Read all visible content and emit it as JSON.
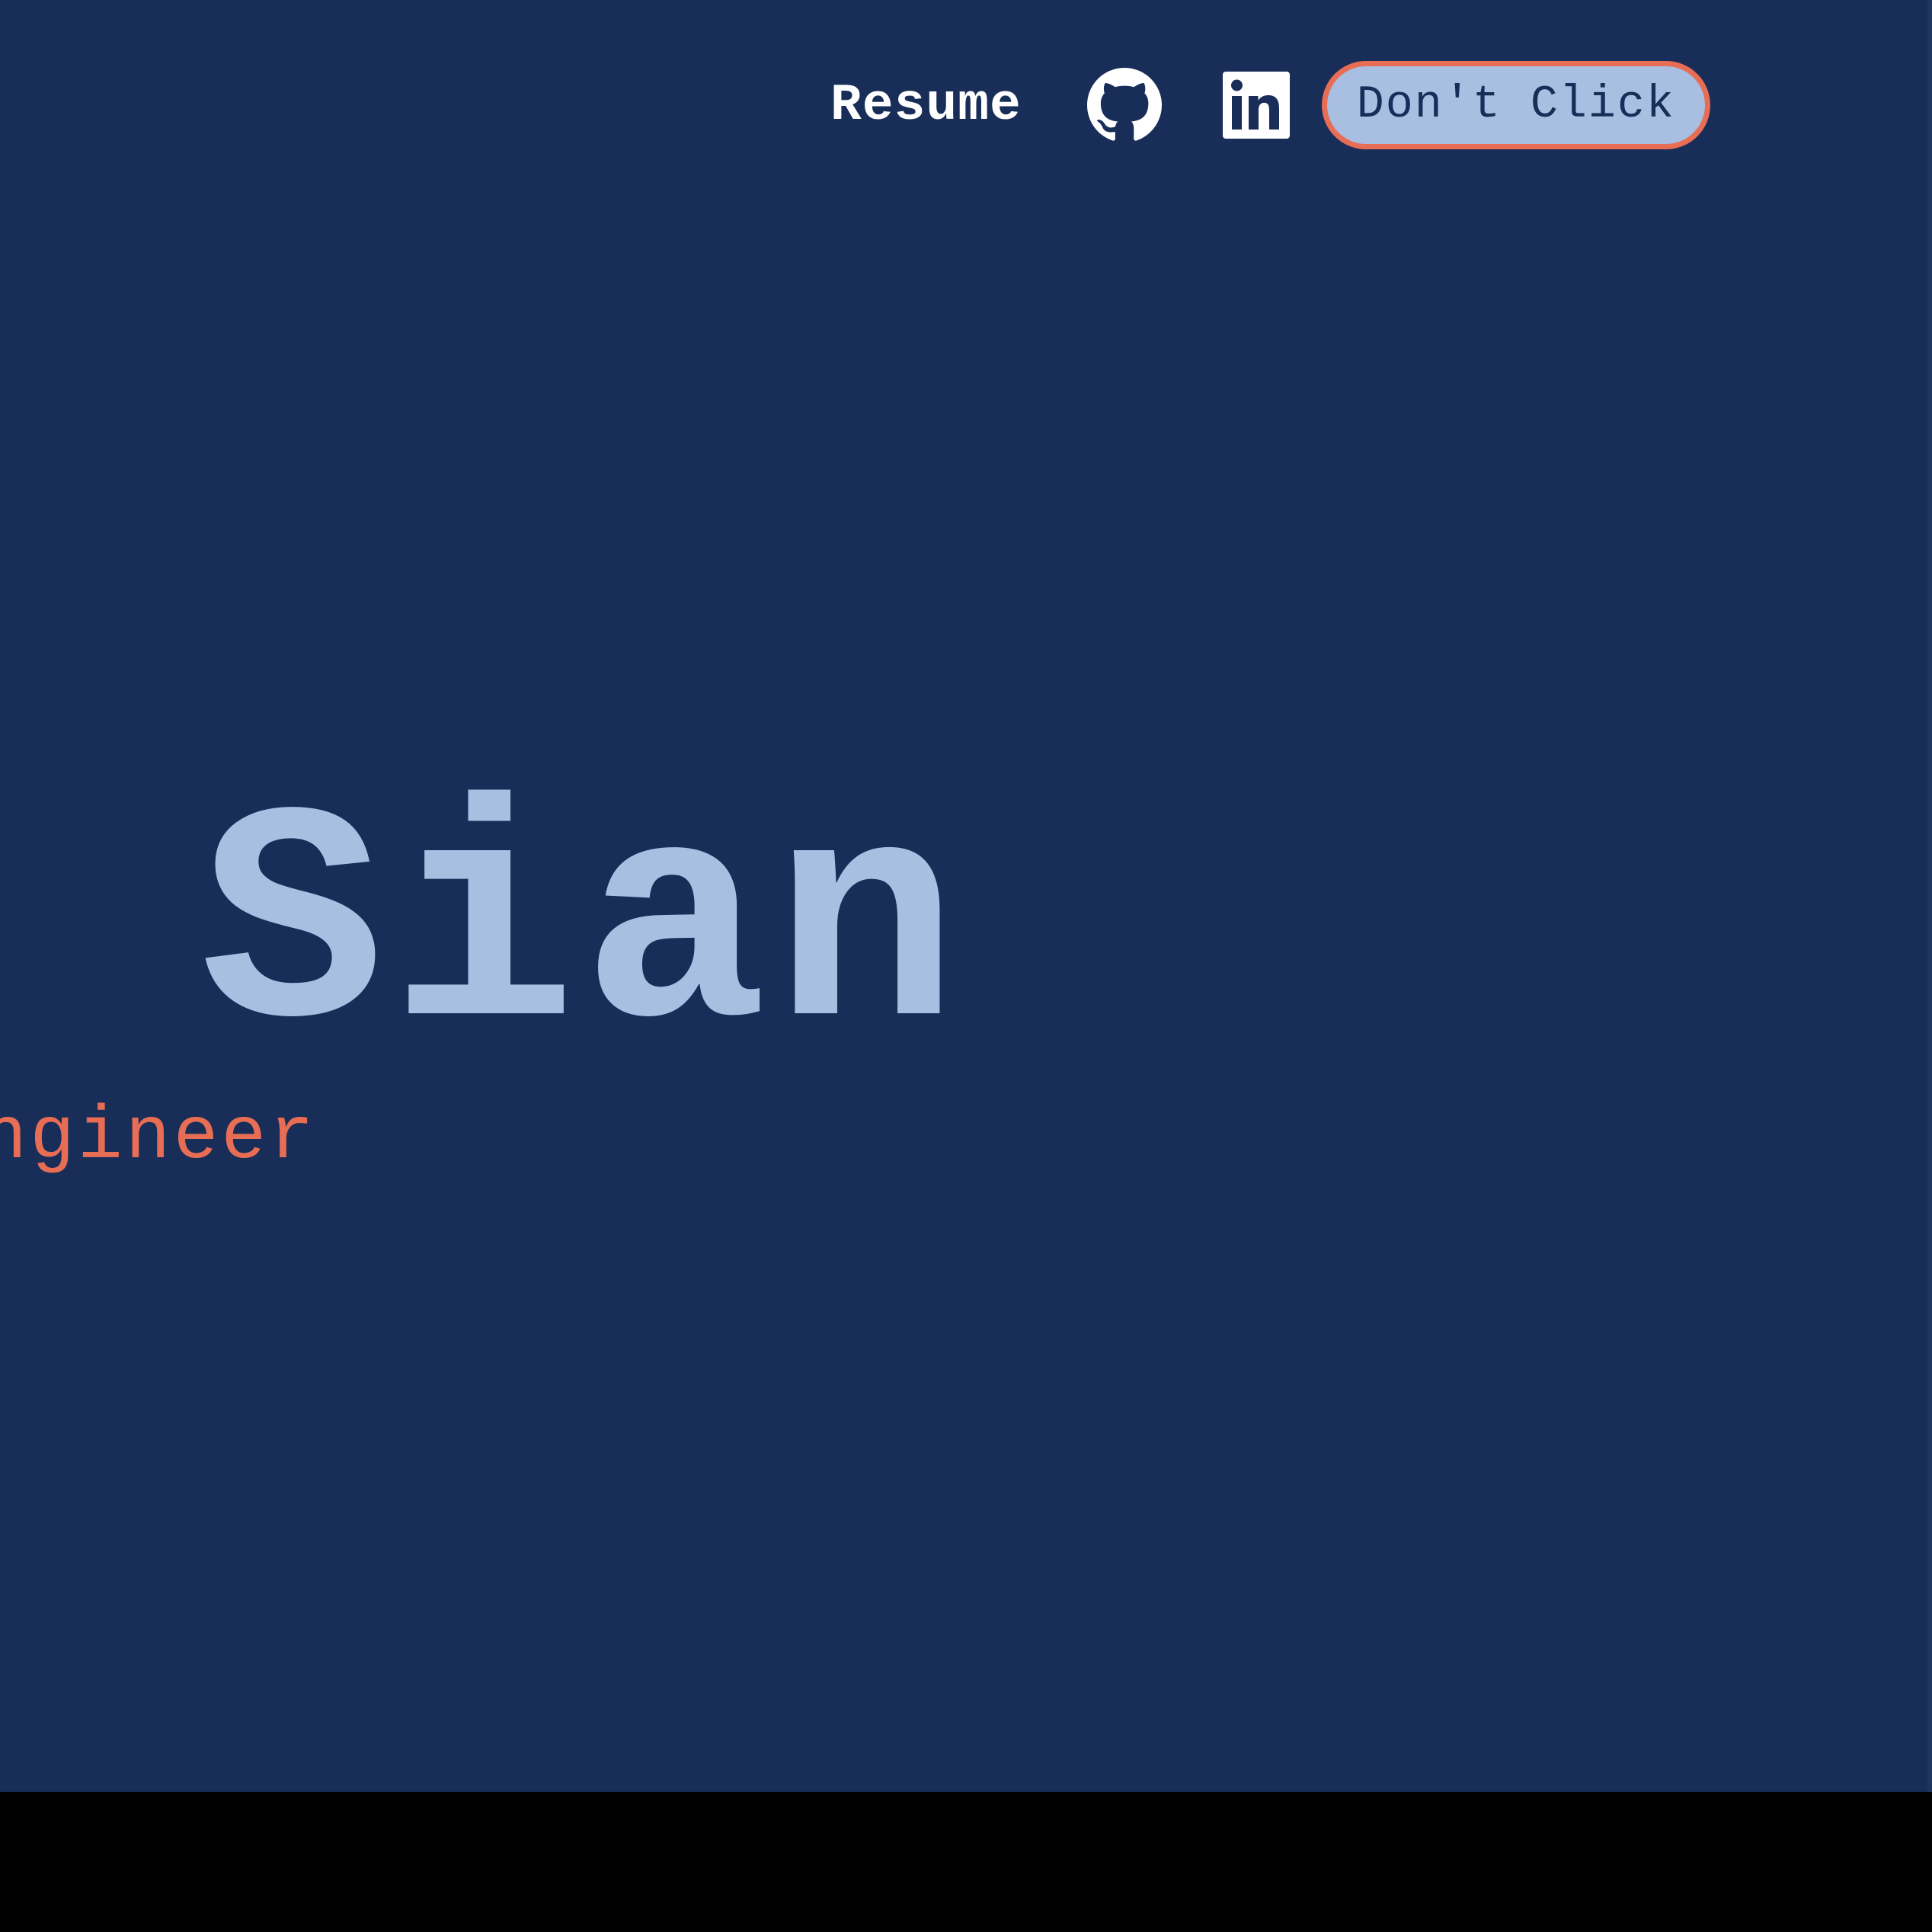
{
  "nav": {
    "resume_label": "Resume",
    "github_icon": "github-icon",
    "linkedin_icon": "linkedin-icon",
    "cta_label": "Don't Click"
  },
  "hero": {
    "name": "Sian",
    "title": "ngineer"
  },
  "colors": {
    "background": "#182d58",
    "accent": "#e76d55",
    "light_blue": "#a8bfe2",
    "text_white": "#ffffff"
  }
}
